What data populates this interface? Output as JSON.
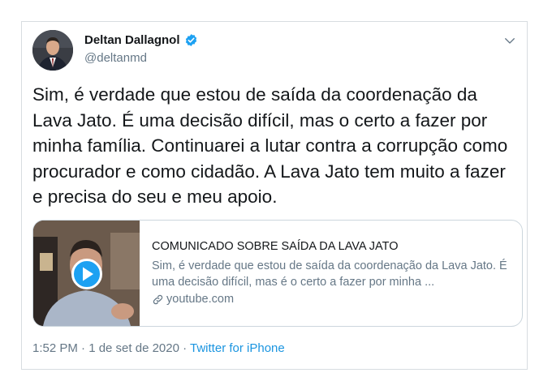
{
  "author": {
    "name": "Deltan Dallagnol",
    "handle": "@deltanmd",
    "verified_color": "#1da1f2"
  },
  "tweet": {
    "text": "Sim, é verdade que estou de saída da coordenação da Lava Jato. É uma decisão difícil, mas o certo a fazer por minha família. Continuarei a lutar contra a corrupção como procurador e como cidadão. A Lava Jato tem muito a fazer e precisa do seu e meu apoio."
  },
  "card": {
    "title": "COMUNICADO SOBRE SAÍDA DA LAVA JATO",
    "description": "Sim, é verdade que estou de saída da coordenação da Lava Jato. É uma decisão difícil, mas é o certo a fazer por minha ...",
    "domain": "youtube.com"
  },
  "footer": {
    "timestamp": "1:52 PM · 1 de set de 2020",
    "separator": " · ",
    "source": "Twitter for iPhone"
  },
  "icons": {
    "menu": "chevron-down-icon",
    "verified": "verified-badge-icon",
    "play": "play-icon",
    "link": "link-icon"
  }
}
